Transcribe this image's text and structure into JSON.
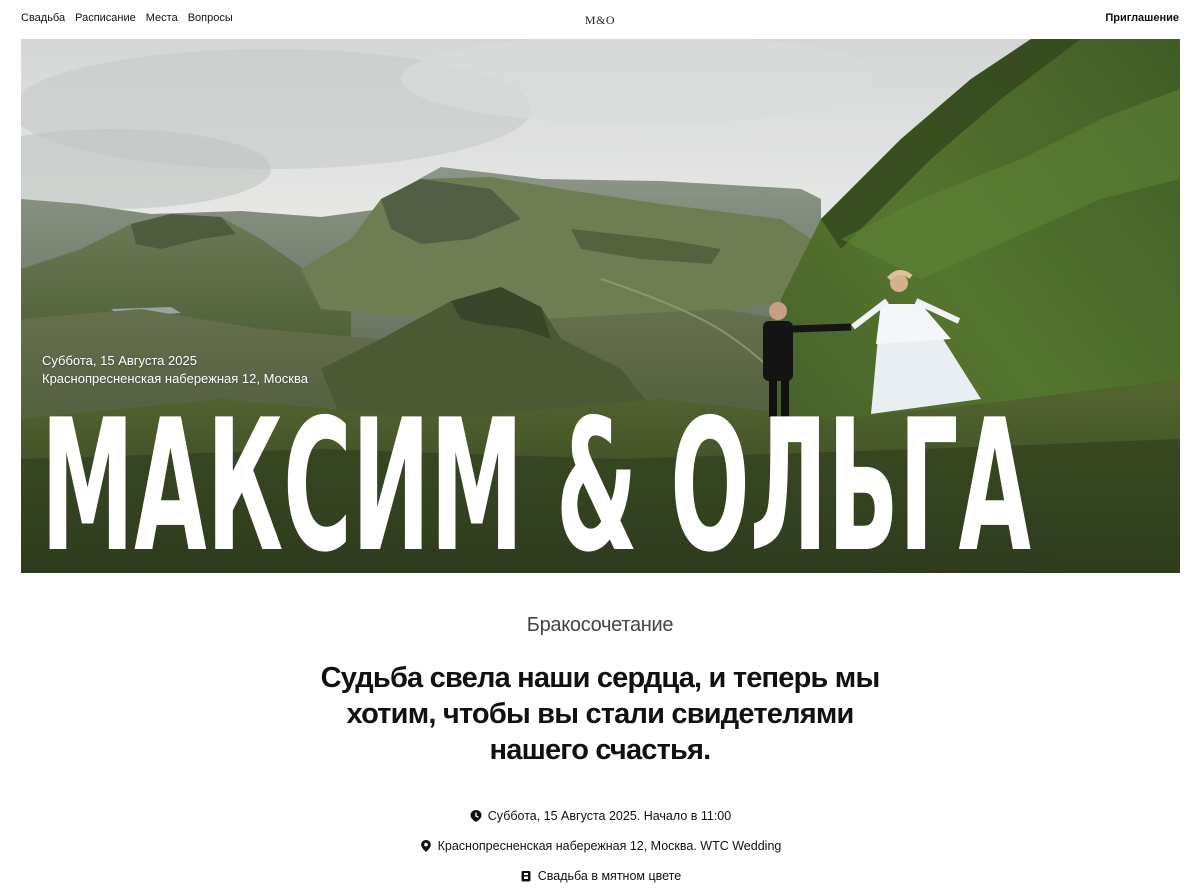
{
  "header": {
    "nav": [
      {
        "label": "Свадьба"
      },
      {
        "label": "Расписание"
      },
      {
        "label": "Места"
      },
      {
        "label": "Вопросы"
      }
    ],
    "logo": "M&O",
    "invite_label": "Приглашение"
  },
  "hero": {
    "date": "Суббота, 15 Августа 2025",
    "address": "Краснопресненская набережная 12, Москва",
    "names": "МАКСИМ & ОЛЬГА"
  },
  "main": {
    "section_label": "Бракосочетание",
    "headline": "Судьба свела наши сердца, и теперь мы хотим, чтобы вы стали свидетелями нашего счастья.",
    "details": [
      {
        "icon": "clock-icon",
        "text": "Суббота, 15 Августа 2025. Начало в 11:00"
      },
      {
        "icon": "location-pin-icon",
        "text": "Краснопресненская набережная 12, Москва. WTC Wedding"
      },
      {
        "icon": "dress-code-icon",
        "text": "Свадьба в мятном цвете"
      }
    ]
  },
  "colors": {
    "sky": "#e6e8e6",
    "grass_dark": "#3f5a2a",
    "grass_light": "#6f8a48",
    "mountain": "#5d6a50",
    "text": "#111111"
  }
}
